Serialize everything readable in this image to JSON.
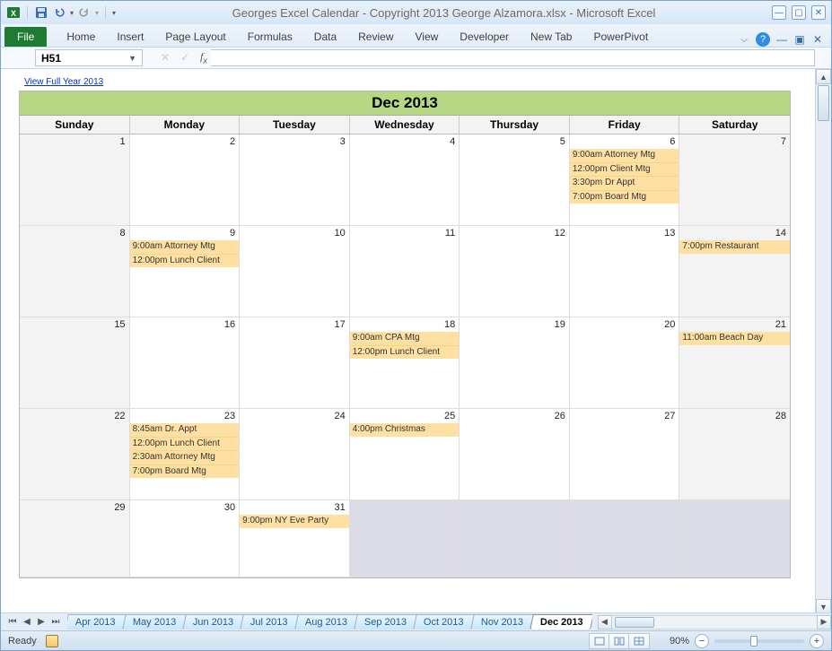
{
  "window": {
    "title": "Georges Excel Calendar - Copyright 2013 George Alzamora.xlsx - Microsoft Excel"
  },
  "ribbon": {
    "file": "File",
    "tabs": [
      "Home",
      "Insert",
      "Page Layout",
      "Formulas",
      "Data",
      "Review",
      "View",
      "Developer",
      "New Tab",
      "PowerPivot"
    ]
  },
  "namebox": "H51",
  "formula": "",
  "link_full_year": "View Full Year 2013",
  "calendar": {
    "title": "Dec 2013",
    "days": [
      "Sunday",
      "Monday",
      "Tuesday",
      "Wednesday",
      "Thursday",
      "Friday",
      "Saturday"
    ],
    "weeks": [
      [
        {
          "n": "1",
          "grey": true
        },
        {
          "n": "2"
        },
        {
          "n": "3"
        },
        {
          "n": "4"
        },
        {
          "n": "5"
        },
        {
          "n": "6",
          "ev": [
            "9:00am Attorney Mtg",
            "12:00pm Client Mtg",
            "3:30pm Dr Appt",
            "7:00pm Board Mtg"
          ]
        },
        {
          "n": "7",
          "grey": true
        }
      ],
      [
        {
          "n": "8",
          "grey": true
        },
        {
          "n": "9",
          "ev": [
            "9:00am Attorney Mtg",
            "12:00pm Lunch Client"
          ]
        },
        {
          "n": "10"
        },
        {
          "n": "11"
        },
        {
          "n": "12"
        },
        {
          "n": "13"
        },
        {
          "n": "14",
          "grey": true,
          "ev": [
            "7:00pm Restaurant"
          ]
        }
      ],
      [
        {
          "n": "15",
          "grey": true
        },
        {
          "n": "16"
        },
        {
          "n": "17"
        },
        {
          "n": "18",
          "ev": [
            "9:00am CPA Mtg",
            "12:00pm Lunch Client"
          ]
        },
        {
          "n": "19"
        },
        {
          "n": "20"
        },
        {
          "n": "21",
          "grey": true,
          "ev": [
            "11:00am Beach Day"
          ]
        }
      ],
      [
        {
          "n": "22",
          "grey": true
        },
        {
          "n": "23",
          "ev": [
            "8:45am Dr. Appt",
            "12:00pm Lunch Client",
            "2:30am Attorney Mtg",
            "7:00pm Board Mtg"
          ]
        },
        {
          "n": "24"
        },
        {
          "n": "25",
          "ev": [
            "4:00pm Christmas"
          ]
        },
        {
          "n": "26"
        },
        {
          "n": "27"
        },
        {
          "n": "28",
          "grey": true
        }
      ],
      [
        {
          "n": "29",
          "grey": true
        },
        {
          "n": "30"
        },
        {
          "n": "31",
          "ev": [
            "9:00pm NY Eve Party"
          ]
        },
        {
          "void": true
        },
        {
          "void": true
        },
        {
          "void": true
        },
        {
          "void": true
        }
      ]
    ]
  },
  "sheet_tabs": [
    "Apr 2013",
    "May 2013",
    "Jun 2013",
    "Jul 2013",
    "Aug 2013",
    "Sep 2013",
    "Oct 2013",
    "Nov 2013",
    "Dec 2013"
  ],
  "active_tab": "Dec 2013",
  "status": {
    "ready": "Ready",
    "zoom": "90%"
  }
}
